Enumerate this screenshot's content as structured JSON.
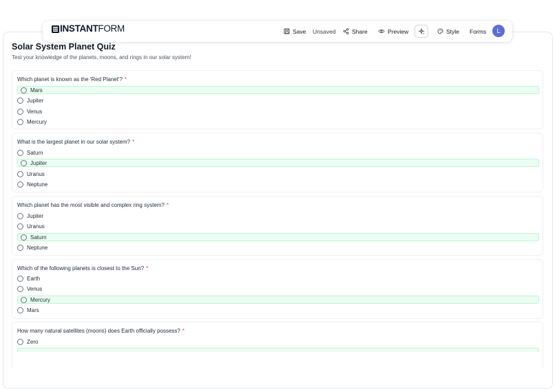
{
  "app": {
    "logo_bold": "INSTANT",
    "logo_light": "FORM"
  },
  "toolbar": {
    "save_label": "Save",
    "status_label": "Unsaved",
    "share_label": "Share",
    "preview_label": "Preview",
    "style_label": "Style",
    "forms_label": "Forms",
    "avatar_initial": "L"
  },
  "quiz": {
    "title": "Solar System Planet Quiz",
    "description": "Test your knowledge of the planets, moons, and rings in our solar system!",
    "questions": [
      {
        "text": "Which planet is known as the 'Red Planet'?",
        "required_mark": "*",
        "options": [
          "Mars",
          "Jupiter",
          "Venus",
          "Mercury"
        ],
        "correct_index": 0
      },
      {
        "text": "What is the largest planet in our solar system?",
        "required_mark": "*",
        "options": [
          "Saturn",
          "Jupiter",
          "Uranus",
          "Neptune"
        ],
        "correct_index": 1
      },
      {
        "text": "Which planet has the most visible and complex ring system?",
        "required_mark": "*",
        "options": [
          "Jupiter",
          "Uranus",
          "Saturn",
          "Neptune"
        ],
        "correct_index": 2
      },
      {
        "text": "Which of the following planets is closest to the Sun?",
        "required_mark": "*",
        "options": [
          "Earth",
          "Venus",
          "Mercury",
          "Mars"
        ],
        "correct_index": 2
      },
      {
        "text": "How many natural satellites (moons) does Earth officially possess?",
        "required_mark": "*",
        "options": [
          "Zero"
        ],
        "correct_index": -1
      }
    ]
  },
  "colors": {
    "correct_bg": "#ecfdf3",
    "correct_border": "#bbf7d0",
    "required": "#ef4444",
    "avatar": "#5b6fd6"
  }
}
